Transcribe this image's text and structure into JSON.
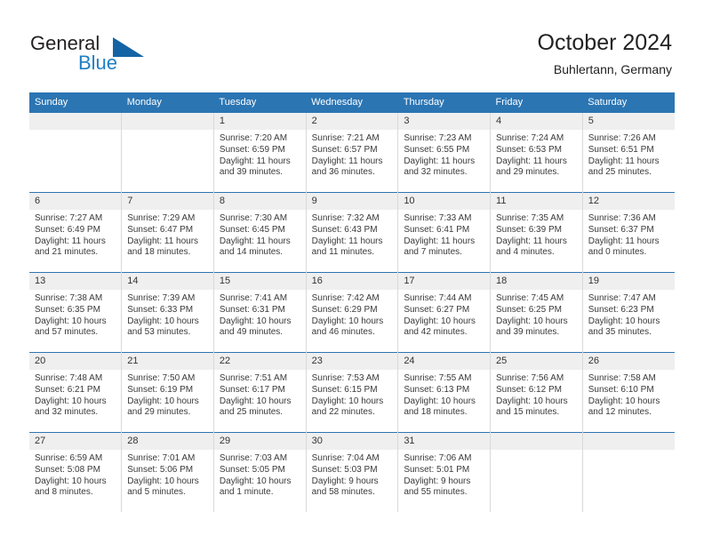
{
  "logo": {
    "word1": "General",
    "word2": "Blue",
    "icon": "triangle-mark",
    "color_dark": "#231f20",
    "color_blue": "#1d7fc3",
    "color_triangle": "#1464a5"
  },
  "header": {
    "title": "October 2024",
    "subtitle": "Buhlertann, Germany"
  },
  "theme": {
    "header_bg": "#2b75b3",
    "header_text": "#ffffff",
    "daynum_bg": "#efefef",
    "cell_border": "#d9d9d9",
    "week_divider": "#2b75b3"
  },
  "weekday_headers": [
    "Sunday",
    "Monday",
    "Tuesday",
    "Wednesday",
    "Thursday",
    "Friday",
    "Saturday"
  ],
  "weeks": [
    [
      {
        "day": "",
        "empty": true,
        "sunrise": "",
        "sunset": "",
        "daylight1": "",
        "daylight2": ""
      },
      {
        "day": "",
        "empty": true,
        "sunrise": "",
        "sunset": "",
        "daylight1": "",
        "daylight2": ""
      },
      {
        "day": "1",
        "empty": false,
        "sunrise": "Sunrise: 7:20 AM",
        "sunset": "Sunset: 6:59 PM",
        "daylight1": "Daylight: 11 hours",
        "daylight2": "and 39 minutes."
      },
      {
        "day": "2",
        "empty": false,
        "sunrise": "Sunrise: 7:21 AM",
        "sunset": "Sunset: 6:57 PM",
        "daylight1": "Daylight: 11 hours",
        "daylight2": "and 36 minutes."
      },
      {
        "day": "3",
        "empty": false,
        "sunrise": "Sunrise: 7:23 AM",
        "sunset": "Sunset: 6:55 PM",
        "daylight1": "Daylight: 11 hours",
        "daylight2": "and 32 minutes."
      },
      {
        "day": "4",
        "empty": false,
        "sunrise": "Sunrise: 7:24 AM",
        "sunset": "Sunset: 6:53 PM",
        "daylight1": "Daylight: 11 hours",
        "daylight2": "and 29 minutes."
      },
      {
        "day": "5",
        "empty": false,
        "sunrise": "Sunrise: 7:26 AM",
        "sunset": "Sunset: 6:51 PM",
        "daylight1": "Daylight: 11 hours",
        "daylight2": "and 25 minutes."
      }
    ],
    [
      {
        "day": "6",
        "empty": false,
        "sunrise": "Sunrise: 7:27 AM",
        "sunset": "Sunset: 6:49 PM",
        "daylight1": "Daylight: 11 hours",
        "daylight2": "and 21 minutes."
      },
      {
        "day": "7",
        "empty": false,
        "sunrise": "Sunrise: 7:29 AM",
        "sunset": "Sunset: 6:47 PM",
        "daylight1": "Daylight: 11 hours",
        "daylight2": "and 18 minutes."
      },
      {
        "day": "8",
        "empty": false,
        "sunrise": "Sunrise: 7:30 AM",
        "sunset": "Sunset: 6:45 PM",
        "daylight1": "Daylight: 11 hours",
        "daylight2": "and 14 minutes."
      },
      {
        "day": "9",
        "empty": false,
        "sunrise": "Sunrise: 7:32 AM",
        "sunset": "Sunset: 6:43 PM",
        "daylight1": "Daylight: 11 hours",
        "daylight2": "and 11 minutes."
      },
      {
        "day": "10",
        "empty": false,
        "sunrise": "Sunrise: 7:33 AM",
        "sunset": "Sunset: 6:41 PM",
        "daylight1": "Daylight: 11 hours",
        "daylight2": "and 7 minutes."
      },
      {
        "day": "11",
        "empty": false,
        "sunrise": "Sunrise: 7:35 AM",
        "sunset": "Sunset: 6:39 PM",
        "daylight1": "Daylight: 11 hours",
        "daylight2": "and 4 minutes."
      },
      {
        "day": "12",
        "empty": false,
        "sunrise": "Sunrise: 7:36 AM",
        "sunset": "Sunset: 6:37 PM",
        "daylight1": "Daylight: 11 hours",
        "daylight2": "and 0 minutes."
      }
    ],
    [
      {
        "day": "13",
        "empty": false,
        "sunrise": "Sunrise: 7:38 AM",
        "sunset": "Sunset: 6:35 PM",
        "daylight1": "Daylight: 10 hours",
        "daylight2": "and 57 minutes."
      },
      {
        "day": "14",
        "empty": false,
        "sunrise": "Sunrise: 7:39 AM",
        "sunset": "Sunset: 6:33 PM",
        "daylight1": "Daylight: 10 hours",
        "daylight2": "and 53 minutes."
      },
      {
        "day": "15",
        "empty": false,
        "sunrise": "Sunrise: 7:41 AM",
        "sunset": "Sunset: 6:31 PM",
        "daylight1": "Daylight: 10 hours",
        "daylight2": "and 49 minutes."
      },
      {
        "day": "16",
        "empty": false,
        "sunrise": "Sunrise: 7:42 AM",
        "sunset": "Sunset: 6:29 PM",
        "daylight1": "Daylight: 10 hours",
        "daylight2": "and 46 minutes."
      },
      {
        "day": "17",
        "empty": false,
        "sunrise": "Sunrise: 7:44 AM",
        "sunset": "Sunset: 6:27 PM",
        "daylight1": "Daylight: 10 hours",
        "daylight2": "and 42 minutes."
      },
      {
        "day": "18",
        "empty": false,
        "sunrise": "Sunrise: 7:45 AM",
        "sunset": "Sunset: 6:25 PM",
        "daylight1": "Daylight: 10 hours",
        "daylight2": "and 39 minutes."
      },
      {
        "day": "19",
        "empty": false,
        "sunrise": "Sunrise: 7:47 AM",
        "sunset": "Sunset: 6:23 PM",
        "daylight1": "Daylight: 10 hours",
        "daylight2": "and 35 minutes."
      }
    ],
    [
      {
        "day": "20",
        "empty": false,
        "sunrise": "Sunrise: 7:48 AM",
        "sunset": "Sunset: 6:21 PM",
        "daylight1": "Daylight: 10 hours",
        "daylight2": "and 32 minutes."
      },
      {
        "day": "21",
        "empty": false,
        "sunrise": "Sunrise: 7:50 AM",
        "sunset": "Sunset: 6:19 PM",
        "daylight1": "Daylight: 10 hours",
        "daylight2": "and 29 minutes."
      },
      {
        "day": "22",
        "empty": false,
        "sunrise": "Sunrise: 7:51 AM",
        "sunset": "Sunset: 6:17 PM",
        "daylight1": "Daylight: 10 hours",
        "daylight2": "and 25 minutes."
      },
      {
        "day": "23",
        "empty": false,
        "sunrise": "Sunrise: 7:53 AM",
        "sunset": "Sunset: 6:15 PM",
        "daylight1": "Daylight: 10 hours",
        "daylight2": "and 22 minutes."
      },
      {
        "day": "24",
        "empty": false,
        "sunrise": "Sunrise: 7:55 AM",
        "sunset": "Sunset: 6:13 PM",
        "daylight1": "Daylight: 10 hours",
        "daylight2": "and 18 minutes."
      },
      {
        "day": "25",
        "empty": false,
        "sunrise": "Sunrise: 7:56 AM",
        "sunset": "Sunset: 6:12 PM",
        "daylight1": "Daylight: 10 hours",
        "daylight2": "and 15 minutes."
      },
      {
        "day": "26",
        "empty": false,
        "sunrise": "Sunrise: 7:58 AM",
        "sunset": "Sunset: 6:10 PM",
        "daylight1": "Daylight: 10 hours",
        "daylight2": "and 12 minutes."
      }
    ],
    [
      {
        "day": "27",
        "empty": false,
        "sunrise": "Sunrise: 6:59 AM",
        "sunset": "Sunset: 5:08 PM",
        "daylight1": "Daylight: 10 hours",
        "daylight2": "and 8 minutes."
      },
      {
        "day": "28",
        "empty": false,
        "sunrise": "Sunrise: 7:01 AM",
        "sunset": "Sunset: 5:06 PM",
        "daylight1": "Daylight: 10 hours",
        "daylight2": "and 5 minutes."
      },
      {
        "day": "29",
        "empty": false,
        "sunrise": "Sunrise: 7:03 AM",
        "sunset": "Sunset: 5:05 PM",
        "daylight1": "Daylight: 10 hours",
        "daylight2": "and 1 minute."
      },
      {
        "day": "30",
        "empty": false,
        "sunrise": "Sunrise: 7:04 AM",
        "sunset": "Sunset: 5:03 PM",
        "daylight1": "Daylight: 9 hours",
        "daylight2": "and 58 minutes."
      },
      {
        "day": "31",
        "empty": false,
        "sunrise": "Sunrise: 7:06 AM",
        "sunset": "Sunset: 5:01 PM",
        "daylight1": "Daylight: 9 hours",
        "daylight2": "and 55 minutes."
      },
      {
        "day": "",
        "empty": true,
        "sunrise": "",
        "sunset": "",
        "daylight1": "",
        "daylight2": ""
      },
      {
        "day": "",
        "empty": true,
        "sunrise": "",
        "sunset": "",
        "daylight1": "",
        "daylight2": ""
      }
    ]
  ]
}
